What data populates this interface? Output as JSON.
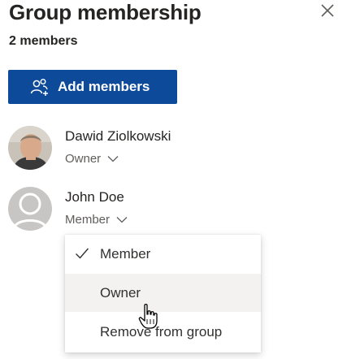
{
  "panel": {
    "title": "Group membership",
    "member_count": "2 members",
    "add_button_label": "Add members"
  },
  "members": [
    {
      "name": "Dawid Ziolkowski",
      "role": "Owner"
    },
    {
      "name": "John Doe",
      "role": "Member"
    }
  ],
  "role_menu": {
    "items": [
      {
        "label": "Member",
        "checked": true
      },
      {
        "label": "Owner",
        "checked": false
      },
      {
        "label": "Remove from group",
        "checked": false
      }
    ]
  },
  "colors": {
    "accent": "#0d4a9a",
    "text": "#252423",
    "subtext": "#605e5c",
    "hover": "#f3f2f1"
  }
}
